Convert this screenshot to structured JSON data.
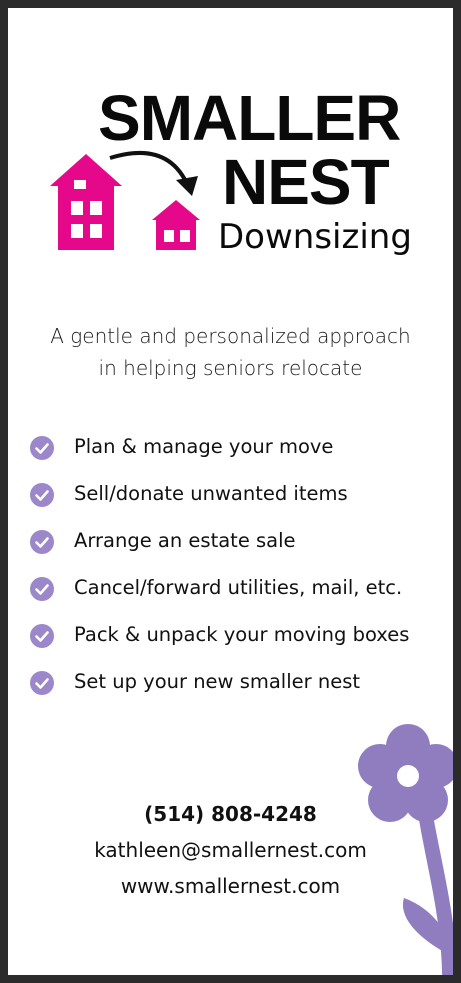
{
  "colors": {
    "brand_pink": "#e6088a",
    "flower_purple": "#8f7dbf",
    "check_purple": "#9b87c9",
    "text": "#111111"
  },
  "logo": {
    "line1": "SMALLER",
    "line2": "NEST",
    "line3": "Downsizing",
    "icon": "houses-arrow-icon"
  },
  "tagline": {
    "line1": "A gentle and personalized approach",
    "line2": "in helping seniors relocate"
  },
  "services": [
    {
      "label": "Plan & manage your move",
      "icon": "check-circle-icon"
    },
    {
      "label": "Sell/donate unwanted items",
      "icon": "check-circle-icon"
    },
    {
      "label": "Arrange an estate sale",
      "icon": "check-circle-icon"
    },
    {
      "label": "Cancel/forward utilities, mail, etc.",
      "icon": "check-circle-icon"
    },
    {
      "label": "Pack & unpack your moving boxes",
      "icon": "check-circle-icon"
    },
    {
      "label": "Set up your new smaller nest",
      "icon": "check-circle-icon"
    }
  ],
  "contact": {
    "phone": "(514) 808-4248",
    "email": "kathleen@smallernest.com",
    "website": "www.smallernest.com"
  }
}
